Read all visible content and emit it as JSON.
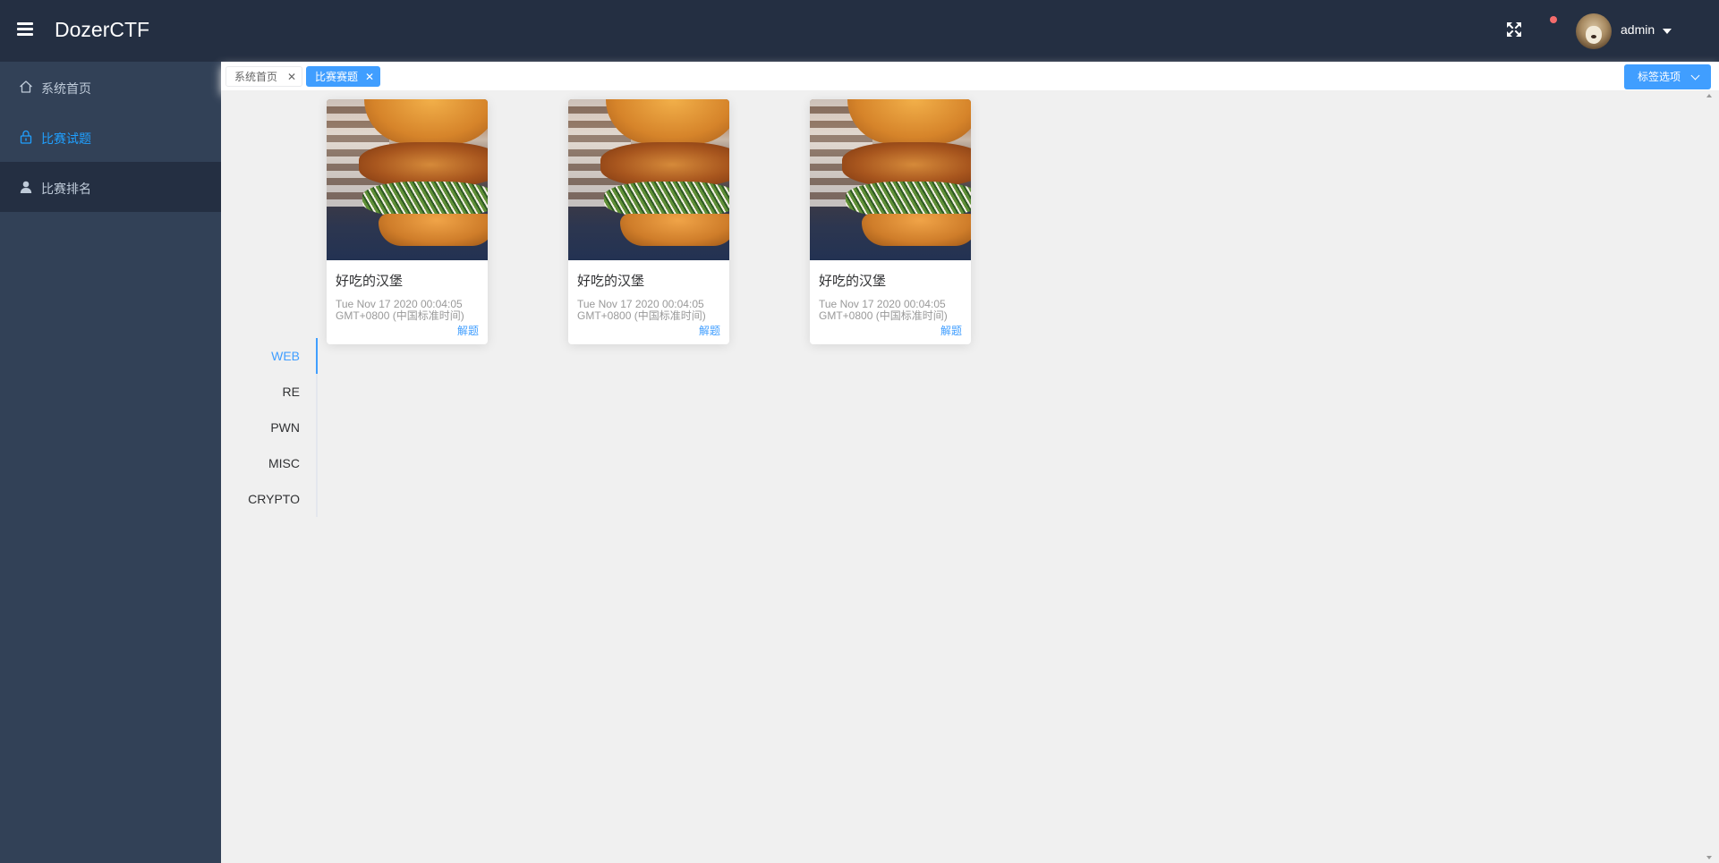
{
  "header": {
    "brand": "DozerCTF",
    "user_name": "admin",
    "colors": {
      "background": "#242f42",
      "notify_dot": "#f56c6c"
    }
  },
  "sidebar": {
    "items": [
      {
        "label": "系统首页",
        "icon": "home-icon",
        "active": false
      },
      {
        "label": "比赛试题",
        "icon": "lock-icon",
        "active": true
      },
      {
        "label": "比赛排名",
        "icon": "user-icon",
        "active": false
      }
    ],
    "colors": {
      "background": "#324157",
      "active_text": "#20a0ff",
      "text": "#bfcbd9"
    }
  },
  "tags": {
    "items": [
      {
        "label": "系统首页",
        "active": false
      },
      {
        "label": "比赛赛题",
        "active": true
      }
    ],
    "options_label": "标签选项",
    "accent": "#409eff"
  },
  "categories": {
    "items": [
      "WEB",
      "RE",
      "PWN",
      "MISC",
      "CRYPTO"
    ],
    "selected": "WEB"
  },
  "challenges": [
    {
      "title": "好吃的汉堡",
      "time": "Tue Nov 17 2020 00:04:05 GMT+0800 (中国标准时间)",
      "action": "解题",
      "image": "burger-image"
    },
    {
      "title": "好吃的汉堡",
      "time": "Tue Nov 17 2020 00:04:05 GMT+0800 (中国标准时间)",
      "action": "解题",
      "image": "burger-image"
    },
    {
      "title": "好吃的汉堡",
      "time": "Tue Nov 17 2020 00:04:05 GMT+0800 (中国标准时间)",
      "action": "解题",
      "image": "burger-image"
    }
  ]
}
